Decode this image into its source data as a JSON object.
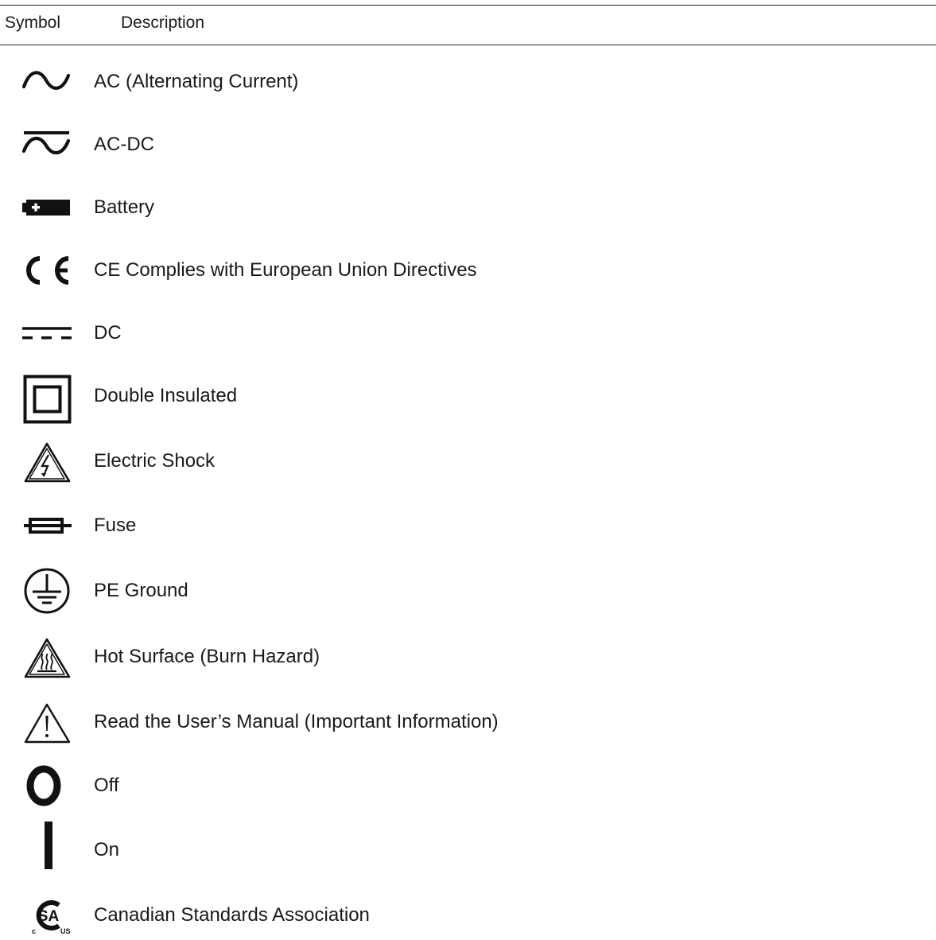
{
  "header": {
    "symbol_col": "Symbol",
    "description_col": "Description"
  },
  "rows": [
    {
      "icon": "ac-sine-icon",
      "description": "AC (Alternating Current)"
    },
    {
      "icon": "ac-dc-icon",
      "description": "AC-DC"
    },
    {
      "icon": "battery-icon",
      "description": "Battery"
    },
    {
      "icon": "ce-mark-icon",
      "description": "CE Complies with European Union Directives"
    },
    {
      "icon": "dc-icon",
      "description": "DC"
    },
    {
      "icon": "double-insulated-icon",
      "description": "Double Insulated"
    },
    {
      "icon": "electric-shock-icon",
      "description": "Electric Shock"
    },
    {
      "icon": "fuse-icon",
      "description": "Fuse"
    },
    {
      "icon": "pe-ground-icon",
      "description": "PE Ground"
    },
    {
      "icon": "hot-surface-icon",
      "description": "Hot Surface (Burn Hazard)"
    },
    {
      "icon": "warning-manual-icon",
      "description": "Read the User’s Manual (Important Information)"
    },
    {
      "icon": "off-icon",
      "description": "Off"
    },
    {
      "icon": "on-icon",
      "description": "On"
    },
    {
      "icon": "csa-logo-icon",
      "description": "Canadian Standards Association",
      "logo_text": [
        "SA",
        "c",
        "US"
      ]
    }
  ]
}
